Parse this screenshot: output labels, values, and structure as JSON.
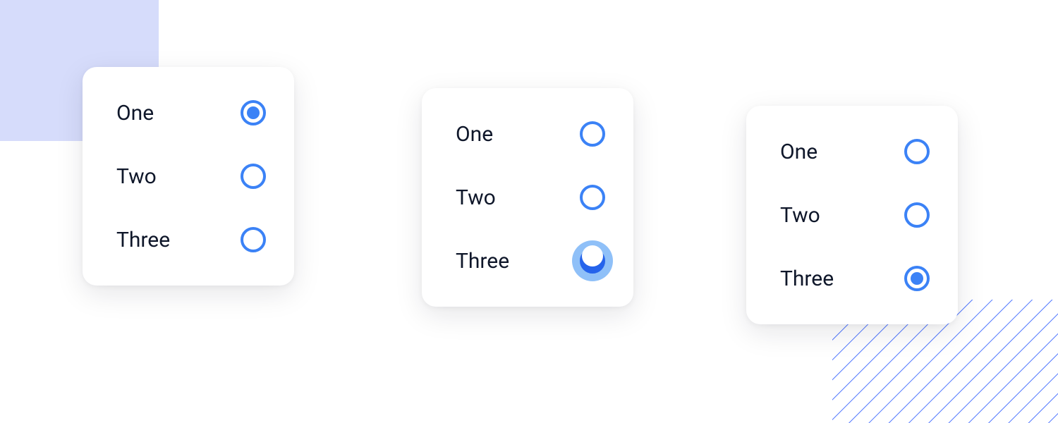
{
  "colors": {
    "primary": "#3b82f6",
    "primary_dark": "#2563eb",
    "halo": "#8fc0f8",
    "bg_square": "#d6dcfb",
    "hatch": "#4f76ff",
    "text": "#0f172a"
  },
  "cards": [
    {
      "id": "card-1",
      "options": [
        {
          "label": "One",
          "state": "checked"
        },
        {
          "label": "Two",
          "state": "unchecked"
        },
        {
          "label": "Three",
          "state": "unchecked"
        }
      ]
    },
    {
      "id": "card-2",
      "options": [
        {
          "label": "One",
          "state": "unchecked"
        },
        {
          "label": "Two",
          "state": "unchecked"
        },
        {
          "label": "Three",
          "state": "pressed-focus"
        }
      ]
    },
    {
      "id": "card-3",
      "options": [
        {
          "label": "One",
          "state": "unchecked"
        },
        {
          "label": "Two",
          "state": "unchecked"
        },
        {
          "label": "Three",
          "state": "checked"
        }
      ]
    }
  ]
}
